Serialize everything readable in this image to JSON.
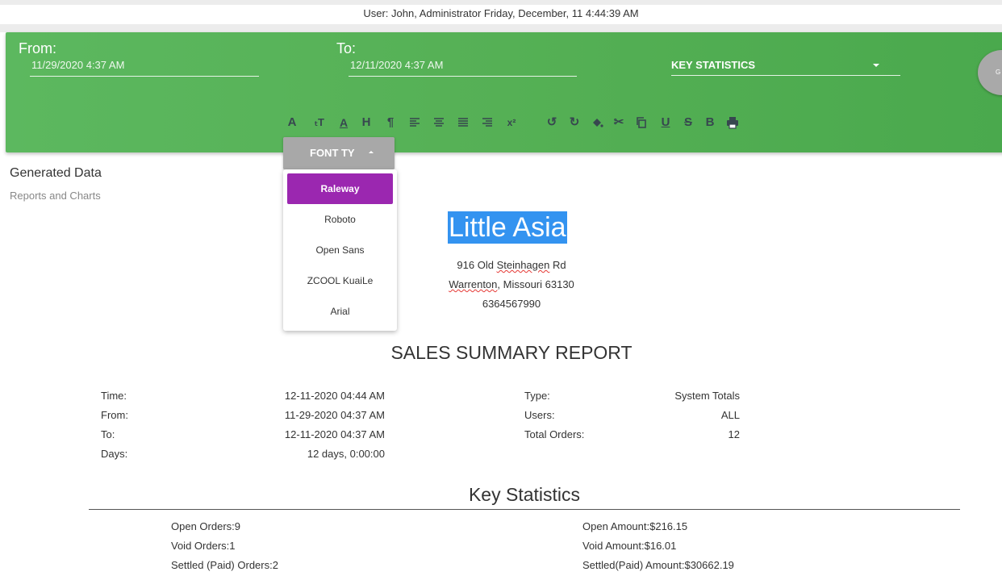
{
  "status": {
    "text": "User: John, Administrator Friday, December, 11 4:44:39 AM"
  },
  "toolbar": {
    "from_label": "From:",
    "from_value": "11/29/2020 4:37 AM",
    "to_label": "To:",
    "to_value": "12/11/2020 4:37 AM",
    "report_select": "KEY STATISTICS",
    "fab_label": "G",
    "icons": [
      "font-icon",
      "font-size-icon",
      "font-color-icon",
      "heading-icon",
      "paragraph-icon",
      "align-left-icon",
      "align-center-icon",
      "align-justify-icon",
      "align-right-icon",
      "superscript-icon",
      "undo-icon",
      "redo-icon",
      "fill-color-icon",
      "cut-icon",
      "copy-icon",
      "underline-icon",
      "strikethrough-icon",
      "bold-icon",
      "print-icon"
    ]
  },
  "font_dropdown": {
    "button_label": "FONT TY",
    "options": [
      "Raleway",
      "Roboto",
      "Open Sans",
      "ZCOOL KuaiLe",
      "Arial"
    ],
    "selected": "Raleway"
  },
  "section": {
    "title": "Generated Data",
    "subtitle": "Reports and Charts"
  },
  "business": {
    "name": "Little Asia",
    "address_pre": "916 Old ",
    "address_misspelled": "Steinhagen",
    "address_post": " Rd",
    "city_misspelled": "Warrenton",
    "city_post": ", Missouri 63130",
    "phone": "6364567990"
  },
  "report": {
    "title": "SALES SUMMARY REPORT",
    "left": [
      {
        "label": "Time:",
        "value": "12-11-2020 04:44 AM"
      },
      {
        "label": "From:",
        "value": "11-29-2020 04:37 AM"
      },
      {
        "label": "To:",
        "value": "12-11-2020 04:37 AM"
      },
      {
        "label": "Days:",
        "value": "12 days, 0:00:00"
      }
    ],
    "right": [
      {
        "label": "Type:",
        "value": "System Totals"
      },
      {
        "label": "Users:",
        "value": "ALL"
      },
      {
        "label": "Total Orders:",
        "value": "12"
      }
    ]
  },
  "key_stats": {
    "title": "Key Statistics",
    "left": [
      "Open Orders:9",
      "Void Orders:1",
      "Settled (Paid) Orders:2"
    ],
    "right": [
      "Open Amount:$216.15",
      "Void Amount:$16.01",
      "Settled(Paid) Amount:$30662.19"
    ]
  },
  "colors": {
    "toolbar_green": "#55b055",
    "selected_purple": "#9b27b0",
    "highlight_blue": "#3393f0"
  }
}
